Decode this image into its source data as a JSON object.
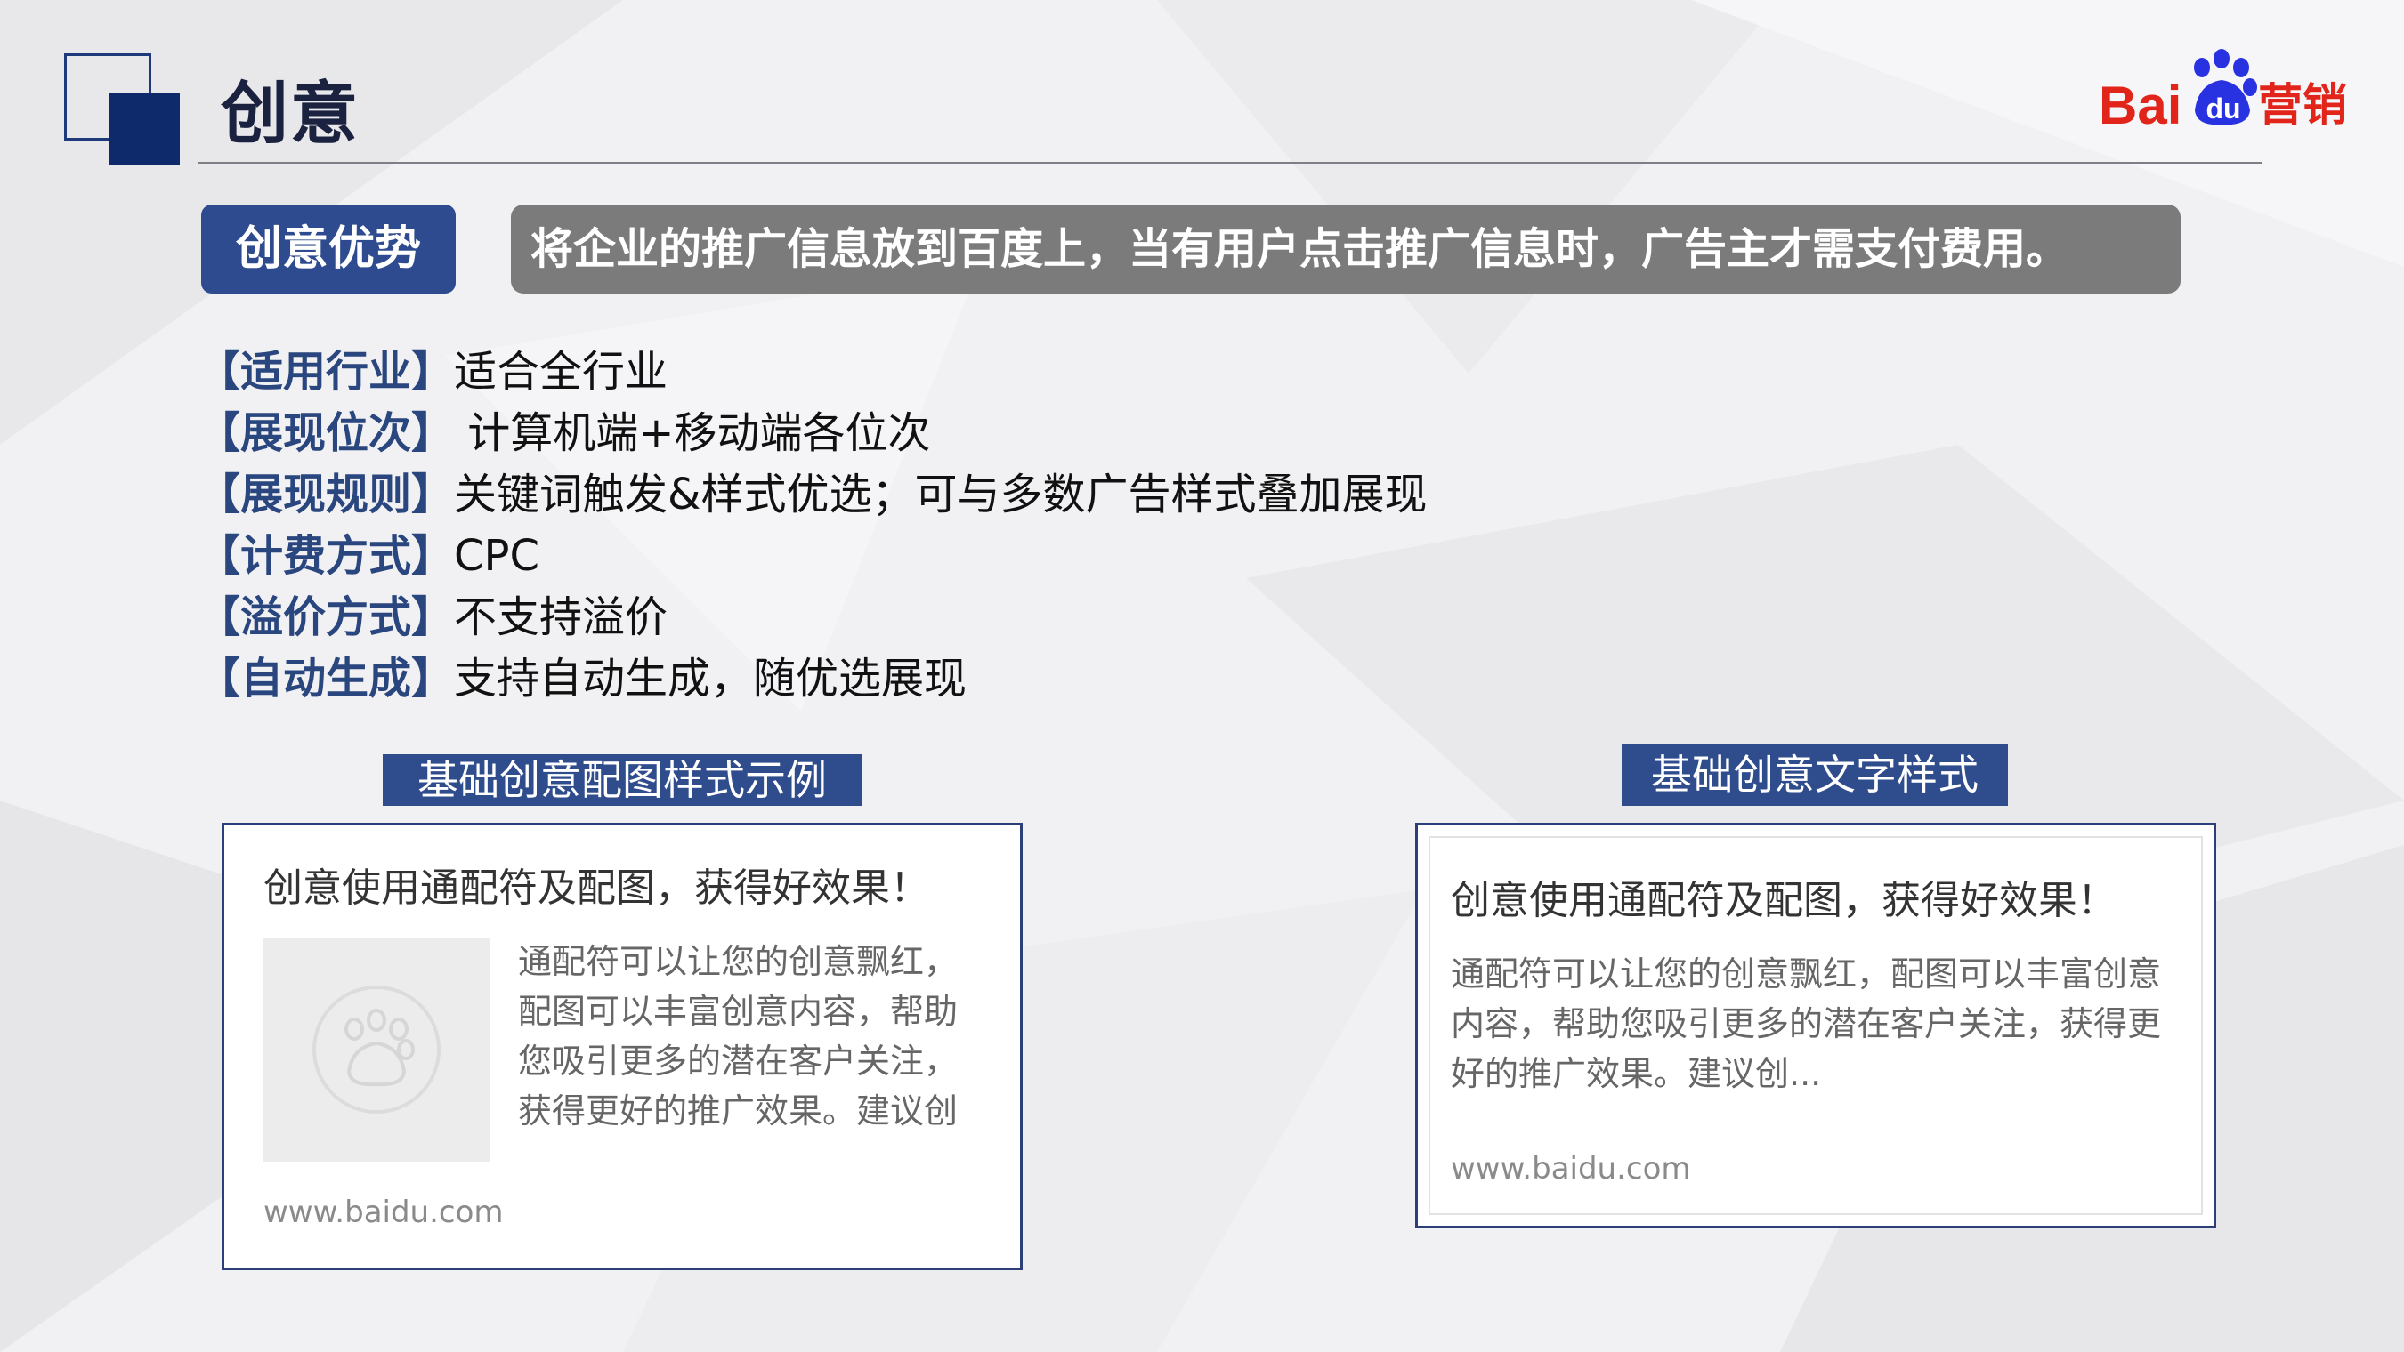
{
  "page": {
    "title": "创意",
    "logo": {
      "text": "Bai",
      "badge": "du",
      "suffix": "营销",
      "color": "#e1251b"
    }
  },
  "advantage": {
    "tag": "创意优势",
    "description": "将企业的推广信息放到百度上，当有用户点击推广信息时，广告主才需支付费用。"
  },
  "features": [
    {
      "key": "【适用行业】",
      "value": "适合全行业"
    },
    {
      "key": "【展现位次】",
      "value": " 计算机端+移动端各位次"
    },
    {
      "key": "【展现规则】",
      "value": "关键词触发&样式优选；可与多数广告样式叠加展现"
    },
    {
      "key": "【计费方式】",
      "value": "CPC"
    },
    {
      "key": "【溢价方式】",
      "value": "不支持溢价"
    },
    {
      "key": "【自动生成】",
      "value": "支持自动生成，随优选展现"
    }
  ],
  "examples": {
    "image_style": {
      "heading": "基础创意配图样式示例",
      "ad_title": "创意使用通配符及配图，获得好效果！",
      "body_lines": [
        "通配符可以让您的创意飘红，",
        "配图可以丰富创意内容，帮助",
        "您吸引更多的潜在客户关注，",
        "获得更好的推广效果。建议创"
      ],
      "url": "www.baidu.com",
      "thumb_icon": "baidu-paw-icon"
    },
    "text_style": {
      "heading": "基础创意文字样式",
      "ad_title": "创意使用通配符及配图，获得好效果！",
      "body_lines": [
        "通配符可以让您的创意飘红，配图可以丰富创意",
        "内容，帮助您吸引更多的潜在客户关注，获得更",
        "好的推广效果。建议创..."
      ],
      "url": "www.baidu.com"
    }
  }
}
